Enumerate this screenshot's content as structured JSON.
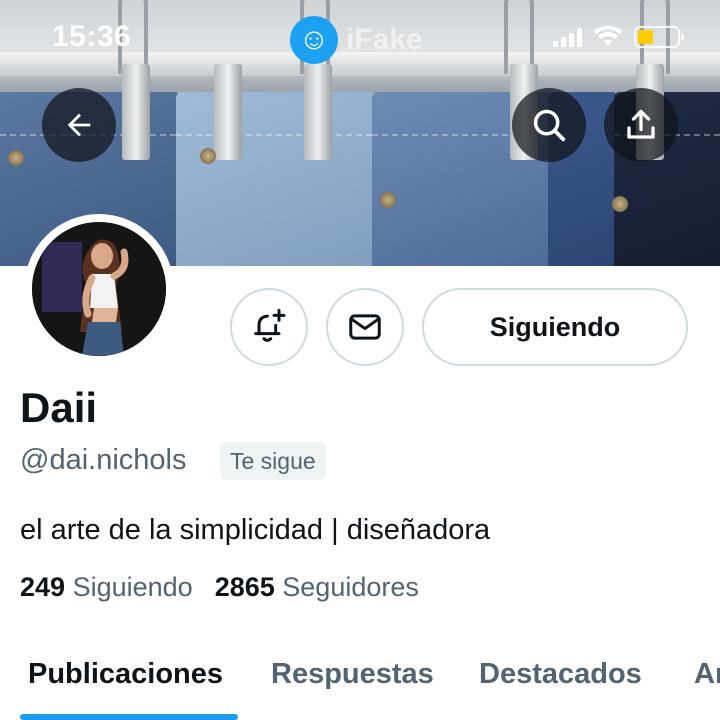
{
  "status_bar": {
    "time": "15:36",
    "watermark": "iFake",
    "battery_level": 0.4,
    "battery_color": "#ffcc00"
  },
  "nav": {
    "back_icon": "arrow-left-icon",
    "search_icon": "search-icon",
    "share_icon": "share-upload-icon"
  },
  "profile": {
    "display_name": "Daii",
    "handle": "@dai.nichols",
    "follows_you": "Te sigue",
    "bio": "el arte de la simplicidad | diseñadora",
    "following_count": "249",
    "following_label": "Siguiendo",
    "followers_count": "2865",
    "followers_label": "Seguidores"
  },
  "actions": {
    "notify_icon": "bell-plus-icon",
    "message_icon": "mail-icon",
    "follow_button": "Siguiendo"
  },
  "tabs": [
    {
      "label": "Publicaciones",
      "active": true
    },
    {
      "label": "Respuestas",
      "active": false
    },
    {
      "label": "Destacados",
      "active": false
    },
    {
      "label": "Ar",
      "active": false
    }
  ],
  "colors": {
    "accent": "#1d9bf0",
    "secondary_text": "#536471",
    "primary_text": "#0f1419",
    "border": "#cfd9de"
  }
}
